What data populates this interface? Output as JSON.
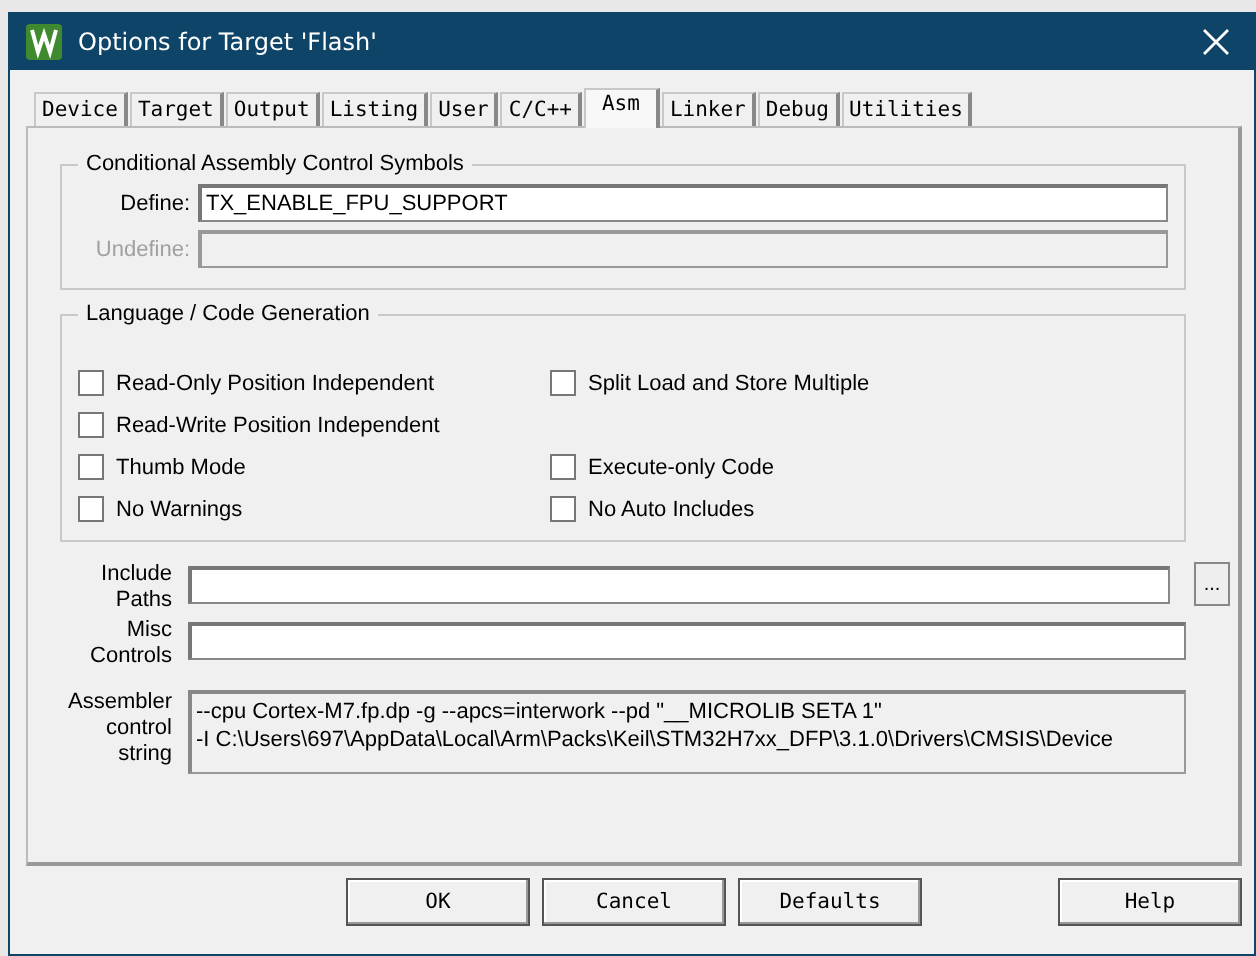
{
  "window": {
    "title": "Options for Target 'Flash'"
  },
  "tabs": [
    {
      "label": "Device",
      "selected": false
    },
    {
      "label": "Target",
      "selected": false
    },
    {
      "label": "Output",
      "selected": false
    },
    {
      "label": "Listing",
      "selected": false
    },
    {
      "label": "User",
      "selected": false
    },
    {
      "label": "C/C++",
      "selected": false
    },
    {
      "label": "Asm",
      "selected": true
    },
    {
      "label": "Linker",
      "selected": false
    },
    {
      "label": "Debug",
      "selected": false
    },
    {
      "label": "Utilities",
      "selected": false
    }
  ],
  "symbols": {
    "title": "Conditional Assembly Control Symbols",
    "fields": [
      {
        "label": "Define:",
        "value": "TX_ENABLE_FPU_SUPPORT",
        "disabled": false
      },
      {
        "label": "Undefine:",
        "disabled": true
      }
    ]
  },
  "codegen": {
    "title": "Language / Code Generation",
    "rows": [
      {
        "left": {
          "label": "Read-Only Position Independent",
          "checked": false
        },
        "right": {
          "label": "Split Load and Store Multiple",
          "checked": false
        }
      },
      {
        "left": {
          "label": "Read-Write Position Independent",
          "checked": false
        }
      },
      {
        "left": {
          "label": "Thumb Mode",
          "checked": false
        },
        "right": {
          "label": "Execute-only Code",
          "checked": false
        }
      },
      {
        "left": {
          "label": "No Warnings",
          "checked": false
        },
        "right": {
          "label": "No Auto Includes",
          "checked": false
        }
      }
    ]
  },
  "include_paths": {
    "label_lines": [
      "Include",
      "Paths"
    ],
    "browse": "..."
  },
  "misc_controls": {
    "label_lines": [
      "Misc",
      "Controls"
    ]
  },
  "assembler_control_string": {
    "label_lines": [
      "Assembler",
      "control",
      "string"
    ],
    "lines": [
      "--cpu Cortex-M7.fp.dp -g --apcs=interwork --pd \"__MICROLIB SETA 1\"",
      "-I C:\\Users\\697\\AppData\\Local\\Arm\\Packs\\Keil\\STM32H7xx_DFP\\3.1.0\\Drivers\\CMSIS\\Device"
    ]
  },
  "buttons": [
    "OK",
    "Cancel",
    "Defaults",
    "Help"
  ]
}
